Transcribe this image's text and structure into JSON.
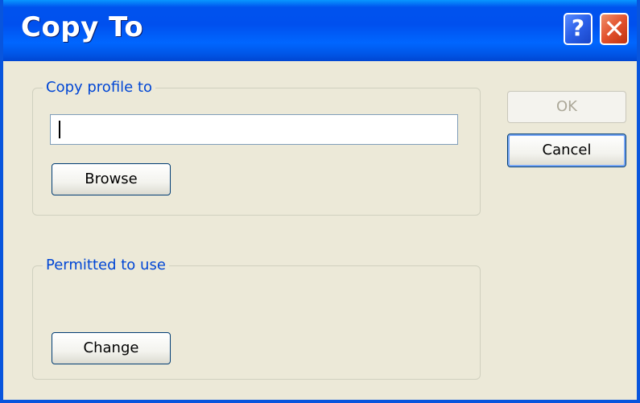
{
  "window": {
    "title": "Copy To",
    "help_glyph": "?",
    "close_glyph": "✕"
  },
  "copy_group": {
    "label": "Copy profile to",
    "input_value": "",
    "browse_label": "Browse"
  },
  "permitted_group": {
    "label": "Permitted to use",
    "change_label": "Change"
  },
  "actions": {
    "ok_label": "OK",
    "cancel_label": "Cancel"
  },
  "colors": {
    "titlebar": "#0054e3",
    "dialog_bg": "#ece9d8",
    "group_label": "#0046d5",
    "close_button": "#e2512d"
  }
}
